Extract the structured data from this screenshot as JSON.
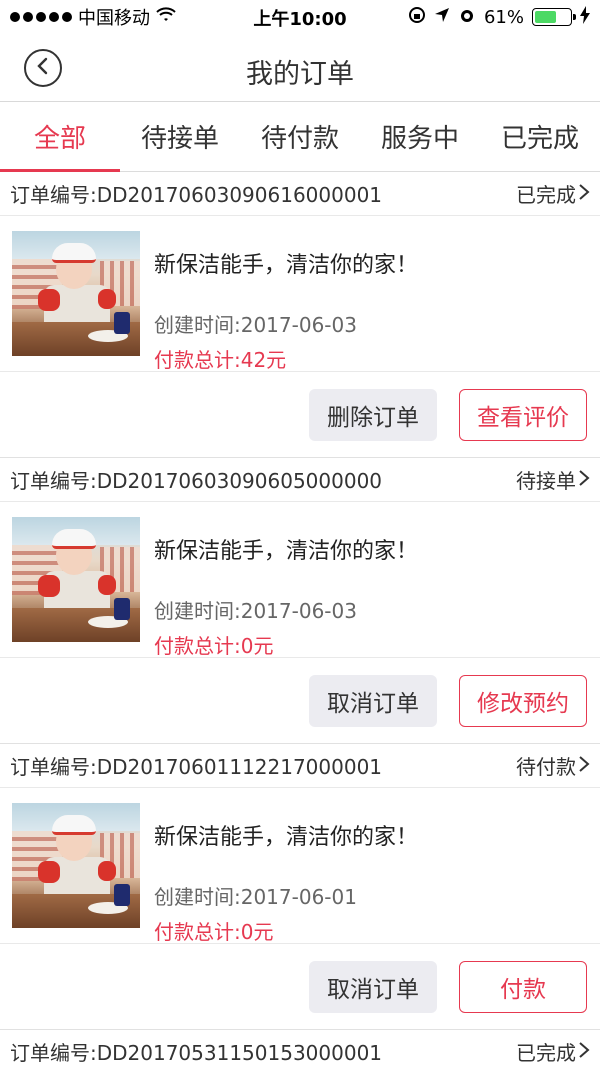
{
  "status_bar": {
    "carrier": "中国移动",
    "time": "上午10:00",
    "battery_percent": "61%",
    "battery_level": 0.61
  },
  "nav": {
    "title": "我的订单"
  },
  "tabs": [
    {
      "label": "全部",
      "active": true
    },
    {
      "label": "待接单",
      "active": false
    },
    {
      "label": "待付款",
      "active": false
    },
    {
      "label": "服务中",
      "active": false
    },
    {
      "label": "已完成",
      "active": false
    }
  ],
  "colors": {
    "accent": "#e63950",
    "battery_green": "#4cd964"
  },
  "orders": [
    {
      "order_no": "订单编号:DD20170603090616000001",
      "status": "已完成",
      "name": "新保洁能手，清洁你的家！",
      "created": "创建时间:2017-06-03",
      "total": "付款总计:42元",
      "action_gray": "删除订单",
      "action_red": "查看评价"
    },
    {
      "order_no": "订单编号:DD20170603090605000000",
      "status": "待接单",
      "name": "新保洁能手，清洁你的家！",
      "created": "创建时间:2017-06-03",
      "total": "付款总计:0元",
      "action_gray": "取消订单",
      "action_red": "修改预约"
    },
    {
      "order_no": "订单编号:DD20170601112217000001",
      "status": "待付款",
      "name": "新保洁能手，清洁你的家！",
      "created": "创建时间:2017-06-01",
      "total": "付款总计:0元",
      "action_gray": "取消订单",
      "action_red": "付款"
    },
    {
      "order_no": "订单编号:DD20170531150153000001",
      "status": "已完成"
    }
  ]
}
